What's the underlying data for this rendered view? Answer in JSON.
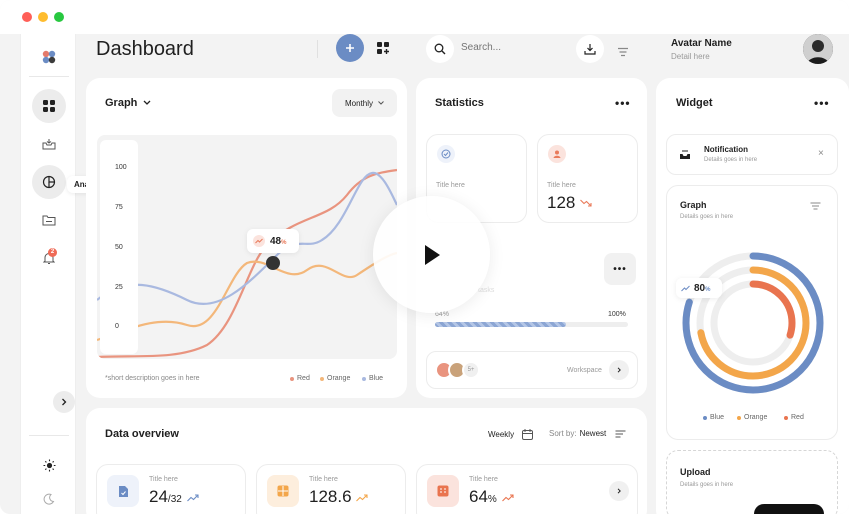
{
  "page": {
    "title": "Dashboard"
  },
  "search": {
    "placeholder": "Search..."
  },
  "user": {
    "name": "Avatar Name",
    "detail": "Detail here"
  },
  "sidebar": {
    "tooltip": "Analytics",
    "notification_count": "2"
  },
  "graph": {
    "title": "Graph",
    "period": "Monthly",
    "description": "*short description goes in here",
    "tooltip_value": "48",
    "tooltip_unit": "%",
    "y_ticks": [
      "100",
      "75",
      "50",
      "25",
      "0"
    ],
    "legend": [
      "Red",
      "Orange",
      "Blue"
    ],
    "colors": {
      "red": "#e9947f",
      "orange": "#f3b77a",
      "blue": "#a9b9e0"
    }
  },
  "statistics": {
    "title": "Statistics",
    "cards": [
      {
        "label": "Title here",
        "value": ""
      },
      {
        "label": "Title here",
        "value": "128"
      }
    ],
    "task_label": "tasks",
    "progress_start": "64%",
    "progress_end": "100%",
    "progress_value": 0.68,
    "extra_members": "5+",
    "workspace_label": "Workspace"
  },
  "widget": {
    "title": "Widget",
    "notification": {
      "title": "Notification",
      "detail": "Details goes in here"
    },
    "graph": {
      "title": "Graph",
      "detail": "Details goes in here",
      "value": "80",
      "unit": "%",
      "legend": [
        "Blue",
        "Orange",
        "Red"
      ]
    },
    "upload": {
      "title": "Upload",
      "detail": "Details goes in here"
    }
  },
  "overview": {
    "title": "Data overview",
    "period": "Weekly",
    "sort_label": "Sort by:",
    "sort_value": "Newest",
    "cards": [
      {
        "label": "Title here",
        "value": "24",
        "suffix": "/32"
      },
      {
        "label": "Title here",
        "value": "128.6",
        "suffix": ""
      },
      {
        "label": "Title here",
        "value": "64",
        "suffix": "%"
      }
    ]
  },
  "colors": {
    "accent": "#6b8cc4",
    "red": "#e9947f",
    "orange": "#f3b77a",
    "blue": "#a9b9e0"
  }
}
